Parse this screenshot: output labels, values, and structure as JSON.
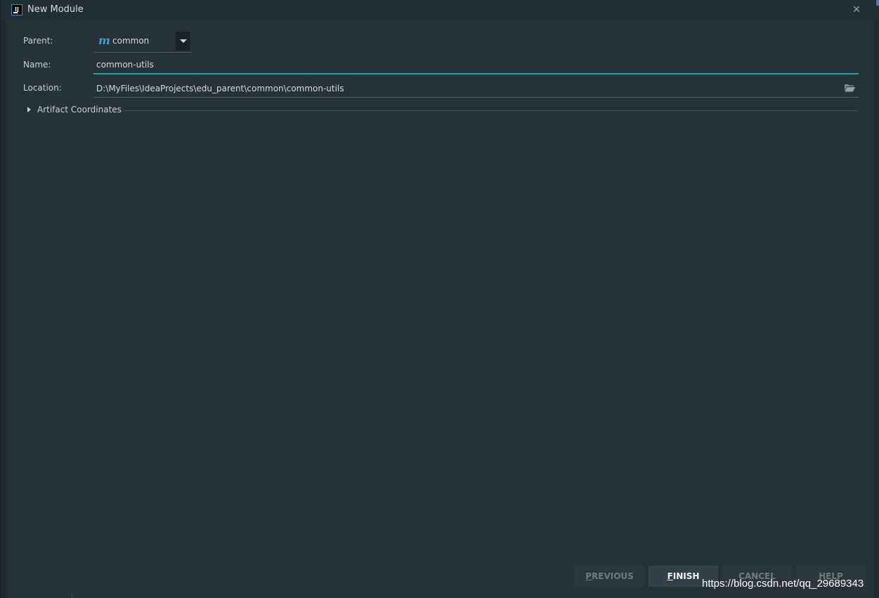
{
  "window": {
    "title": "New Module",
    "app_icon_text": "IJ"
  },
  "form": {
    "parent_label": "Parent:",
    "parent_value": "common",
    "parent_icon_letter": "m",
    "name_label": "Name:",
    "name_value": "common-utils",
    "location_label": "Location:",
    "location_value": "D:\\MyFiles\\IdeaProjects\\edu_parent\\common\\common-utils"
  },
  "section": {
    "artifact_label": "Artifact Coordinates"
  },
  "buttons": {
    "previous_first": "P",
    "previous_rest": "REVIOUS",
    "finish_first": "F",
    "finish_rest": "INISH",
    "cancel": "CANCEL",
    "help": "HELP"
  },
  "watermark": "https://blog.csdn.net/qq_29689343",
  "colors": {
    "accent_underline": "#2f9e9a",
    "module_icon": "#3d9fd6",
    "background": "#263238"
  }
}
